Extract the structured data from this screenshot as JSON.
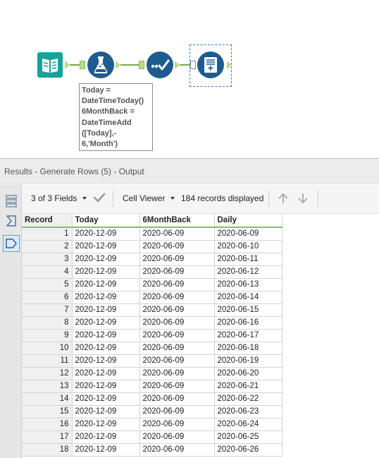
{
  "workflow": {
    "tools": [
      {
        "name": "Input",
        "icon": "book-icon",
        "color": "#19a19b"
      },
      {
        "name": "Formula",
        "icon": "formula-flask-icon",
        "color": "#1e5b8f"
      },
      {
        "name": "Select",
        "icon": "checkmark-path-icon",
        "color": "#1e5b8f"
      },
      {
        "name": "Generate Rows",
        "icon": "generate-rows-icon",
        "color": "#1e5b8f"
      }
    ],
    "annotation": "Today =\nDateTimeToday()\n6MonthBack =\nDateTimeAdd\n([Today],-\n6,'Month')"
  },
  "results": {
    "title": "Results - Generate Rows (5) - Output",
    "fields_label": "3 of 3 Fields",
    "viewer_label": "Cell Viewer",
    "records_label": "184 records displayed",
    "columns": [
      "Record",
      "Today",
      "6MonthBack",
      "Daily"
    ],
    "rows": [
      [
        "1",
        "2020-12-09",
        "2020-06-09",
        "2020-06-09"
      ],
      [
        "2",
        "2020-12-09",
        "2020-06-09",
        "2020-06-10"
      ],
      [
        "3",
        "2020-12-09",
        "2020-06-09",
        "2020-06-11"
      ],
      [
        "4",
        "2020-12-09",
        "2020-06-09",
        "2020-06-12"
      ],
      [
        "5",
        "2020-12-09",
        "2020-06-09",
        "2020-06-13"
      ],
      [
        "6",
        "2020-12-09",
        "2020-06-09",
        "2020-06-14"
      ],
      [
        "7",
        "2020-12-09",
        "2020-06-09",
        "2020-06-15"
      ],
      [
        "8",
        "2020-12-09",
        "2020-06-09",
        "2020-06-16"
      ],
      [
        "9",
        "2020-12-09",
        "2020-06-09",
        "2020-06-17"
      ],
      [
        "10",
        "2020-12-09",
        "2020-06-09",
        "2020-06-18"
      ],
      [
        "11",
        "2020-12-09",
        "2020-06-09",
        "2020-06-19"
      ],
      [
        "12",
        "2020-12-09",
        "2020-06-09",
        "2020-06-20"
      ],
      [
        "13",
        "2020-12-09",
        "2020-06-09",
        "2020-06-21"
      ],
      [
        "14",
        "2020-12-09",
        "2020-06-09",
        "2020-06-22"
      ],
      [
        "15",
        "2020-12-09",
        "2020-06-09",
        "2020-06-23"
      ],
      [
        "16",
        "2020-12-09",
        "2020-06-09",
        "2020-06-24"
      ],
      [
        "17",
        "2020-12-09",
        "2020-06-09",
        "2020-06-25"
      ],
      [
        "18",
        "2020-12-09",
        "2020-06-09",
        "2020-06-26"
      ]
    ]
  },
  "colors": {
    "input_tool": "#19a19b",
    "dev_tool": "#1e5b8f",
    "connector": "#b9dc8a",
    "header_underline": "#86c34d"
  }
}
